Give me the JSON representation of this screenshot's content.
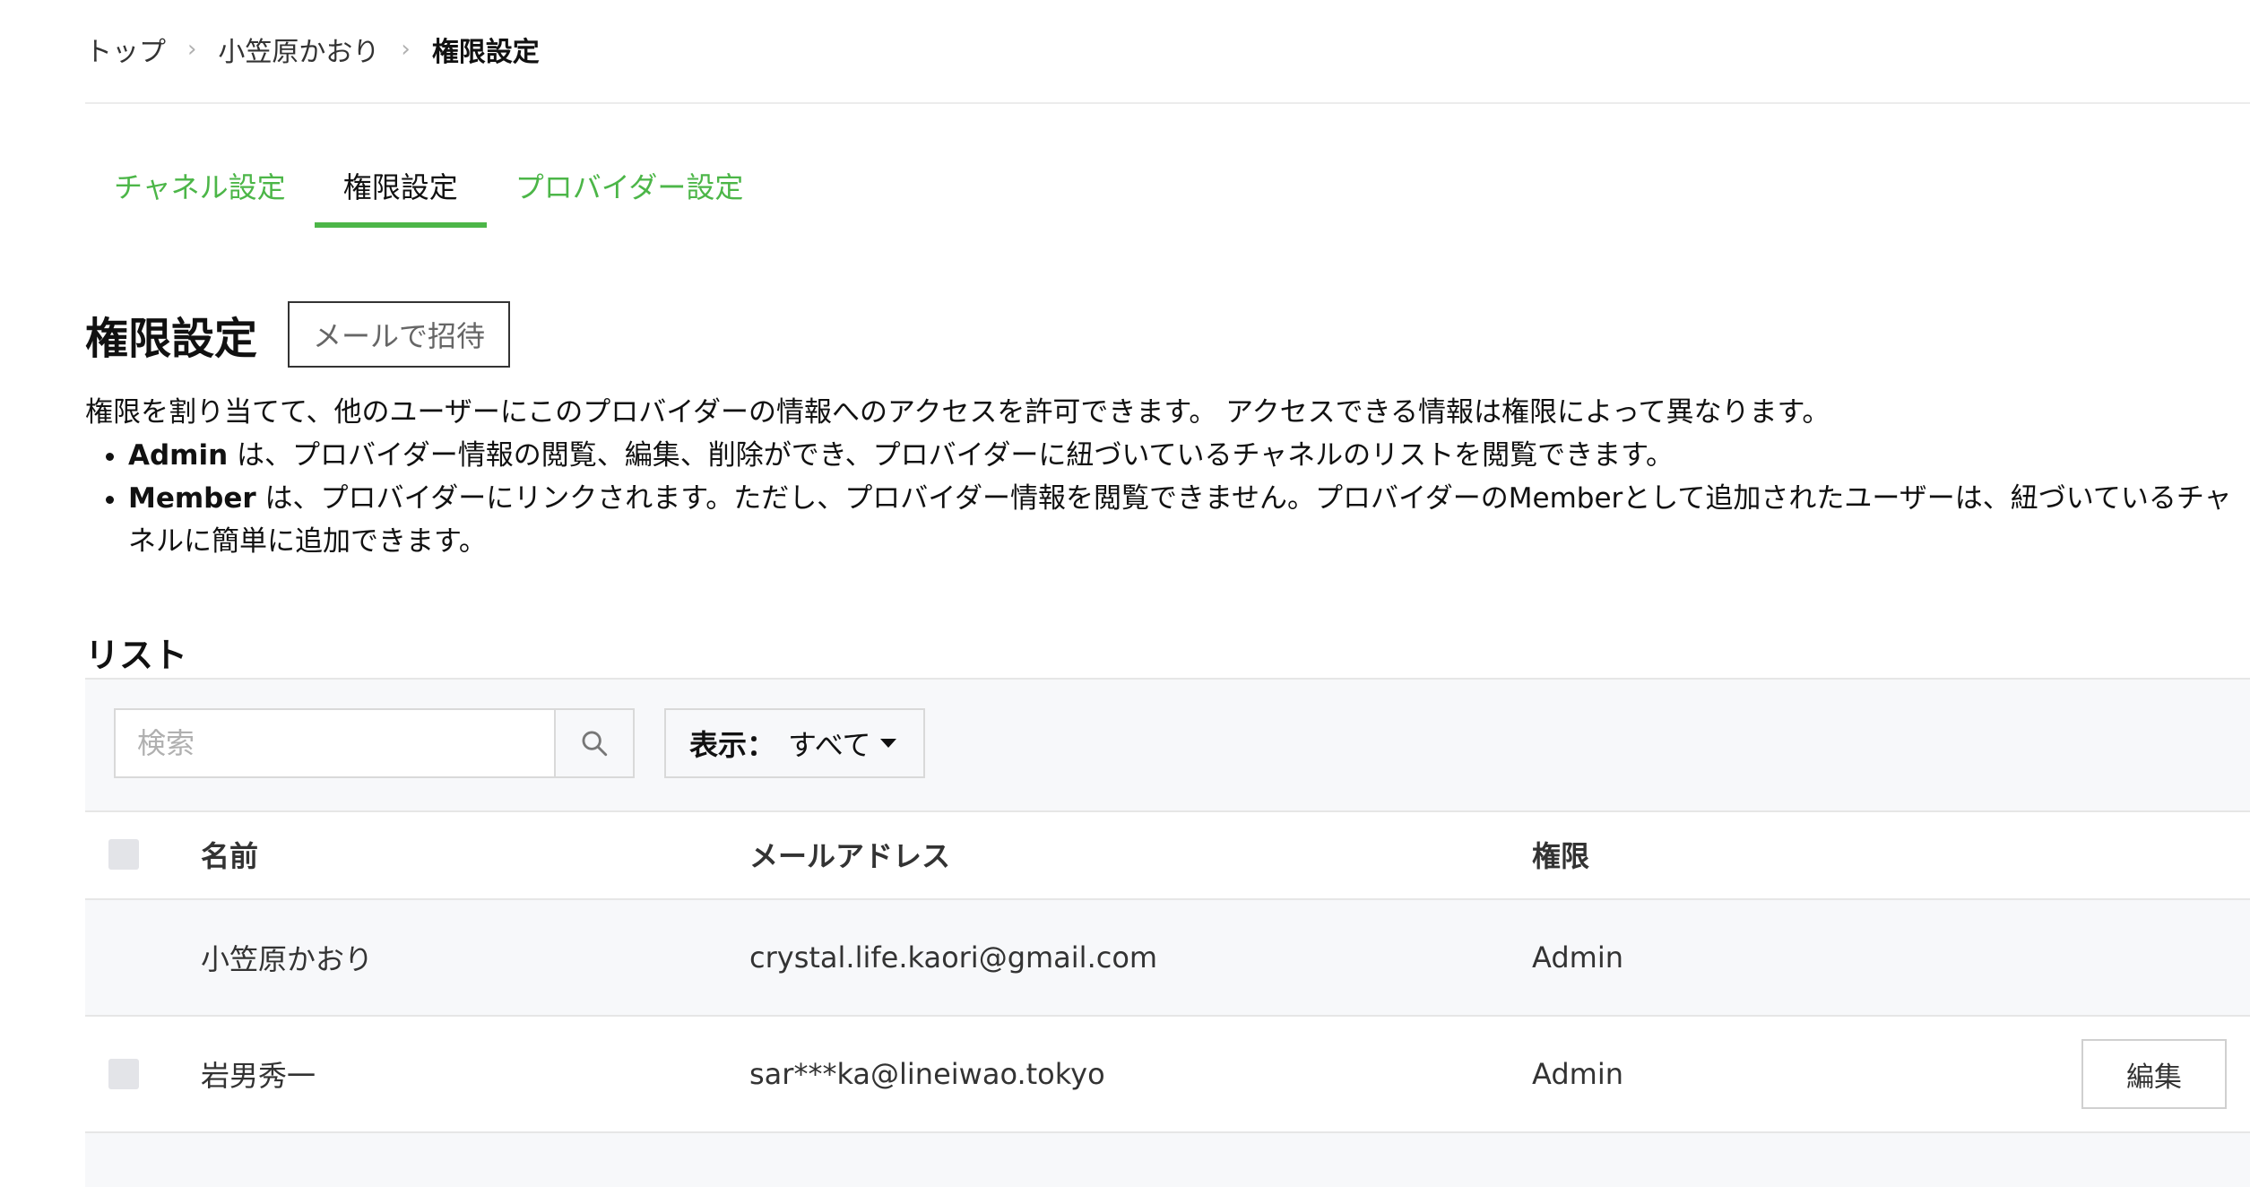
{
  "breadcrumb": {
    "items": [
      "トップ",
      "小笠原かおり",
      "権限設定"
    ]
  },
  "tabs": [
    {
      "label": "チャネル設定",
      "active": false
    },
    {
      "label": "権限設定",
      "active": true
    },
    {
      "label": "プロバイダー設定",
      "active": false
    }
  ],
  "section": {
    "title": "権限設定",
    "invite_label": "メールで招待",
    "description": "権限を割り当てて、他のユーザーにこのプロバイダーの情報へのアクセスを許可できます。 アクセスできる情報は権限によって異なります。",
    "bullets": [
      {
        "term": "Admin",
        "text": " は、プロバイダー情報の閲覧、編集、削除ができ、プロバイダーに紐づいているチャネルのリストを閲覧できます。"
      },
      {
        "term": "Member",
        "text": " は、プロバイダーにリンクされます。ただし、プロバイダー情報を閲覧できません。プロバイダーのMemberとして追加されたユーザーは、紐づいているチャネルに簡単に追加できます。"
      }
    ]
  },
  "list": {
    "title": "リスト",
    "search": {
      "placeholder": "検索",
      "value": ""
    },
    "filter": {
      "label": "表示：",
      "value": "すべて"
    },
    "columns": {
      "name": "名前",
      "email": "メールアドレス",
      "role": "権限"
    },
    "rows": [
      {
        "name": "小笠原かおり",
        "email": "crystal.life.kaori@gmail.com",
        "role": "Admin",
        "selectable": false,
        "editable": false
      },
      {
        "name": "岩男秀一",
        "email": "sar***ka@lineiwao.tokyo",
        "role": "Admin",
        "selectable": true,
        "editable": true,
        "edit_label": "編集"
      }
    ]
  },
  "colors": {
    "accent": "#4cb648",
    "text": "#111111",
    "muted": "#b0b0b0",
    "panel": "#f7f8fa"
  },
  "icons": {
    "search_button": "search-icon",
    "breadcrumb_separator": "chevron-right-icon",
    "filter_dropdown": "caret-down-icon"
  }
}
